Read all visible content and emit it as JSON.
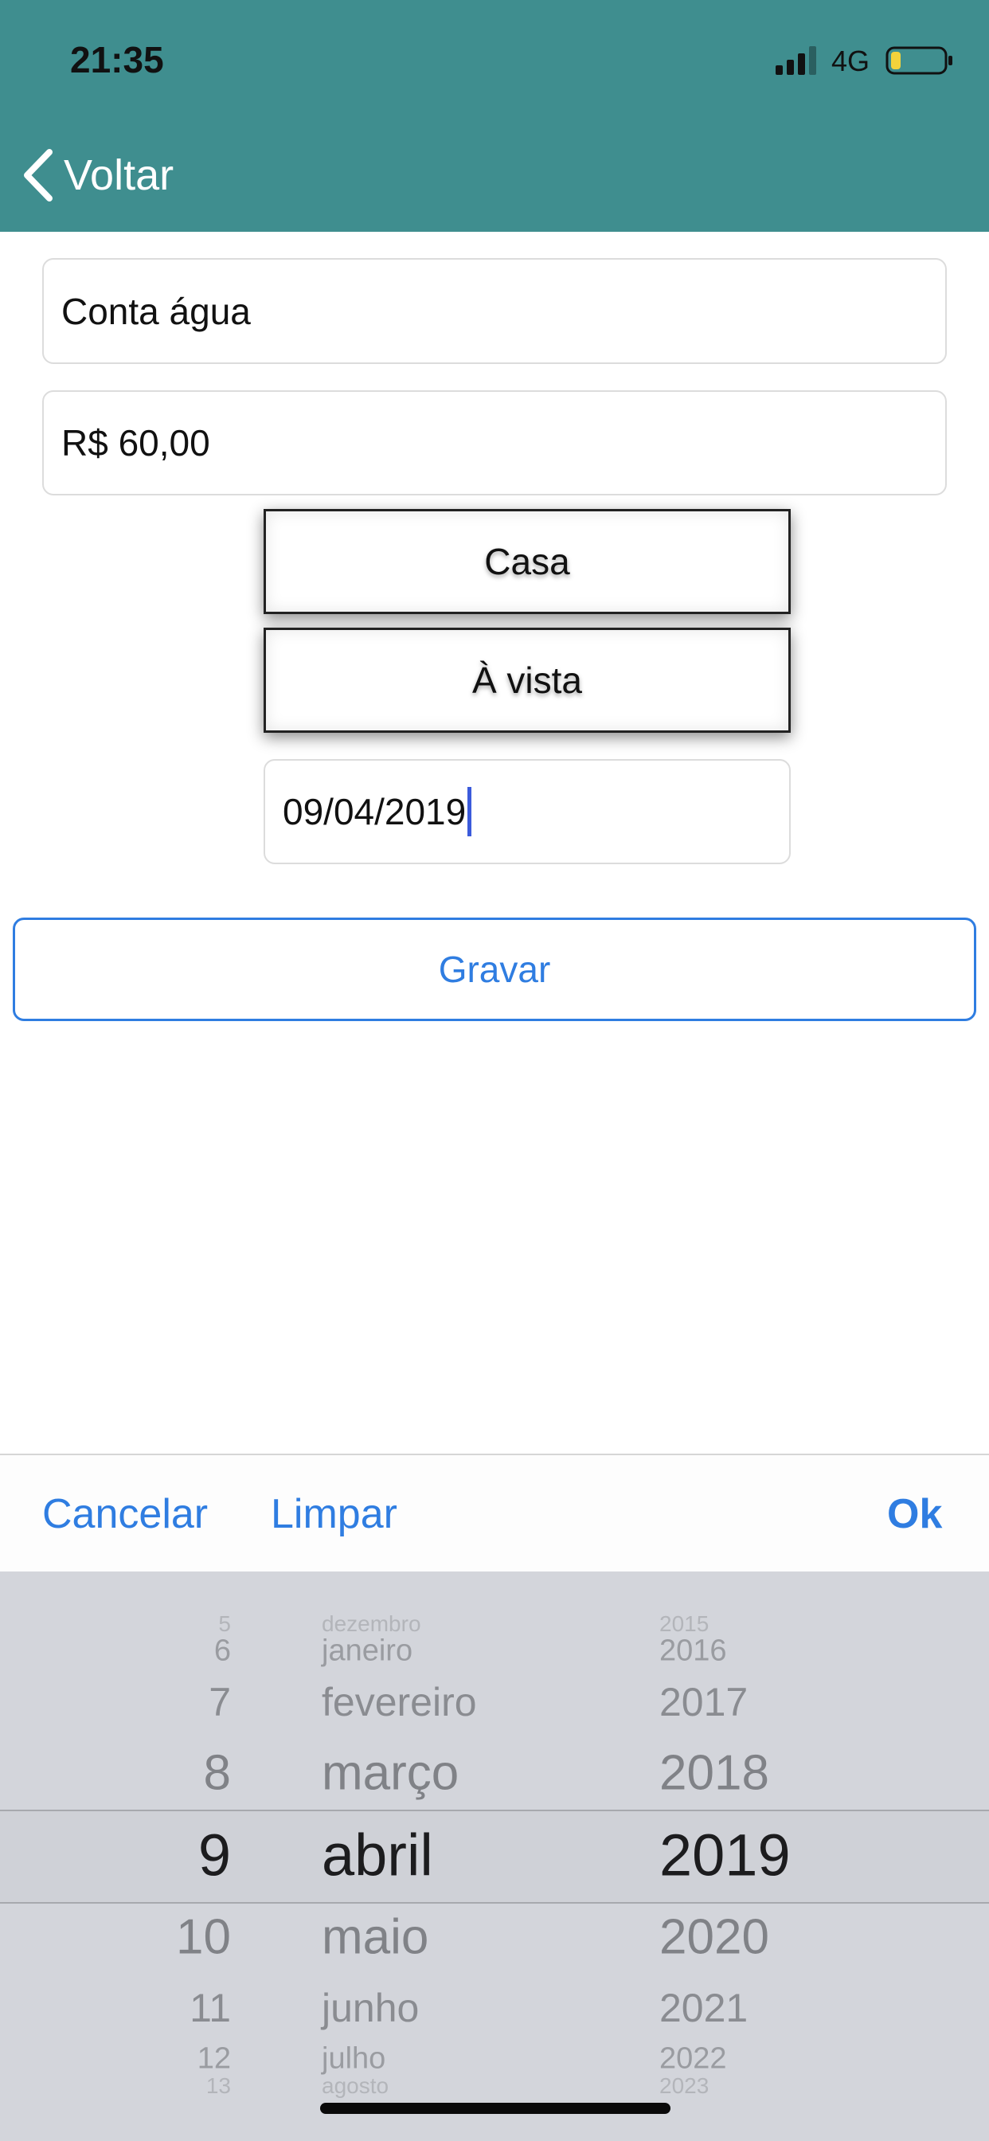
{
  "status_bar": {
    "time": "21:35",
    "network": "4G"
  },
  "nav": {
    "back_label": "Voltar"
  },
  "form": {
    "description_value": "Conta água",
    "amount_value": "R$ 60,00",
    "category_label": "Casa",
    "payment_label": "À vista",
    "date_value": "09/04/2019",
    "save_label": "Gravar"
  },
  "toolbar": {
    "cancel_label": "Cancelar",
    "clear_label": "Limpar",
    "ok_label": "Ok"
  },
  "picker": {
    "days": [
      "5",
      "6",
      "7",
      "8",
      "9",
      "10",
      "11",
      "12",
      "13"
    ],
    "months": [
      "dezembro",
      "janeiro",
      "fevereiro",
      "março",
      "abril",
      "maio",
      "junho",
      "julho",
      "agosto"
    ],
    "years": [
      "2015",
      "2016",
      "2017",
      "2018",
      "2019",
      "2020",
      "2021",
      "2022",
      "2023"
    ],
    "selected": {
      "day": "9",
      "month": "abril",
      "year": "2019"
    }
  },
  "colors": {
    "header": "#3f8e8f",
    "accent": "#2f7de1",
    "picker_bg": "#d3d5db",
    "caret": "#3b5bdb"
  },
  "icons": {
    "back": "chevron-left-icon",
    "signal": "signal-bars-icon",
    "battery": "battery-low-icon"
  }
}
